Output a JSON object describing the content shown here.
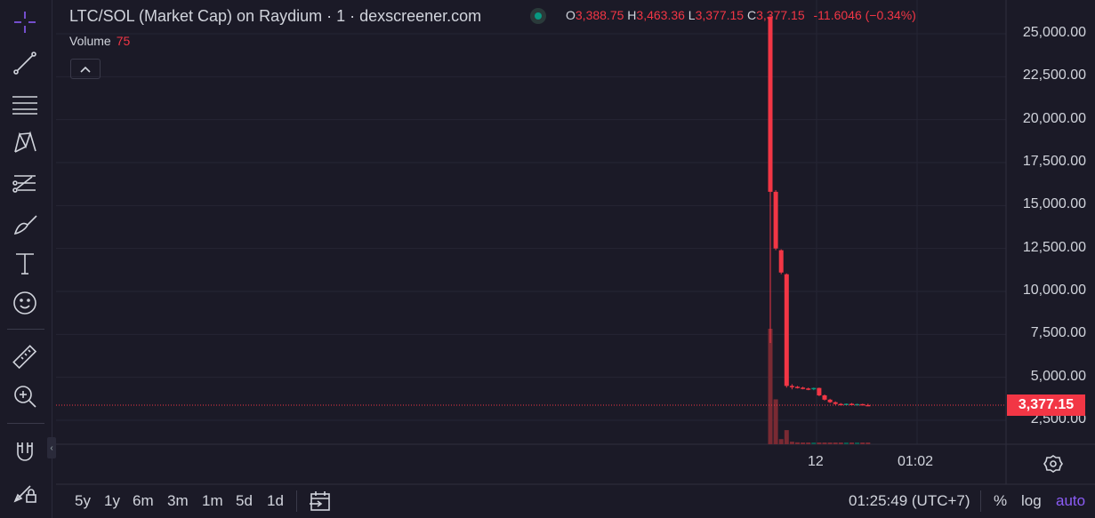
{
  "chart_title": "LTC/SOL (Market Cap) on Raydium · 1 · dexscreener.com",
  "ohlc": {
    "o_label": "O",
    "o_value": "3,388.75",
    "h_label": "H",
    "h_value": "3,463.36",
    "l_label": "L",
    "l_value": "3,377.15",
    "c_label": "C",
    "c_value": "3,377.15",
    "change": "-11.6046 (−0.34%)"
  },
  "volume": {
    "label": "Volume",
    "value": "75"
  },
  "y_axis_ticks": [
    "25,000.00",
    "22,500.00",
    "20,000.00",
    "17,500.00",
    "15,000.00",
    "12,500.00",
    "10,000.00",
    "7,500.00",
    "5,000.00",
    "2,500.00"
  ],
  "last_price": "3,377.15",
  "x_axis_ticks": [
    "12",
    "01:02"
  ],
  "ranges": [
    "5y",
    "1y",
    "6m",
    "3m",
    "1m",
    "5d",
    "1d"
  ],
  "clock": "01:25:49 (UTC+7)",
  "scale_options": {
    "percent": "%",
    "log": "log",
    "auto": "auto"
  },
  "colors": {
    "down": "#f23645",
    "up": "#089981",
    "auto": "#8b5cf6"
  },
  "tools": [
    "crosshair-icon",
    "trend-line-icon",
    "horizontal-lines-icon",
    "pattern-icon",
    "fib-icon",
    "brush-icon",
    "text-icon",
    "emoji-icon",
    "ruler-icon",
    "zoom-in-icon",
    "magnet-icon",
    "lock-drawing-icon"
  ],
  "chart_data": {
    "type": "candlestick",
    "title": "LTC/SOL (Market Cap) on Raydium · 1 · dexscreener.com",
    "ylim": [
      1500,
      26000
    ],
    "y_ticks": [
      2500,
      5000,
      7500,
      10000,
      12500,
      15000,
      17500,
      20000,
      22500,
      25000
    ],
    "x_ticks": [
      "12",
      "01:02"
    ],
    "candles": [
      {
        "o": 26000,
        "h": 26000,
        "l": 7000,
        "c": 15800,
        "dir": "down"
      },
      {
        "o": 15800,
        "h": 15900,
        "l": 12400,
        "c": 12500,
        "dir": "down"
      },
      {
        "o": 12400,
        "h": 12450,
        "l": 11000,
        "c": 11100,
        "dir": "down"
      },
      {
        "o": 11000,
        "h": 11050,
        "l": 4400,
        "c": 4500,
        "dir": "down"
      },
      {
        "o": 4500,
        "h": 4600,
        "l": 4300,
        "c": 4450,
        "dir": "down"
      },
      {
        "o": 4450,
        "h": 4500,
        "l": 4350,
        "c": 4400,
        "dir": "down"
      },
      {
        "o": 4400,
        "h": 4450,
        "l": 4300,
        "c": 4350,
        "dir": "down"
      },
      {
        "o": 4350,
        "h": 4400,
        "l": 4250,
        "c": 4300,
        "dir": "down"
      },
      {
        "o": 4300,
        "h": 4400,
        "l": 4250,
        "c": 4380,
        "dir": "up"
      },
      {
        "o": 4380,
        "h": 4400,
        "l": 3900,
        "c": 3950,
        "dir": "down"
      },
      {
        "o": 3950,
        "h": 4000,
        "l": 3650,
        "c": 3700,
        "dir": "down"
      },
      {
        "o": 3700,
        "h": 3750,
        "l": 3500,
        "c": 3550,
        "dir": "down"
      },
      {
        "o": 3550,
        "h": 3600,
        "l": 3400,
        "c": 3450,
        "dir": "down"
      },
      {
        "o": 3450,
        "h": 3500,
        "l": 3400,
        "c": 3420,
        "dir": "down"
      },
      {
        "o": 3420,
        "h": 3480,
        "l": 3400,
        "c": 3460,
        "dir": "up"
      },
      {
        "o": 3460,
        "h": 3500,
        "l": 3380,
        "c": 3400,
        "dir": "down"
      },
      {
        "o": 3400,
        "h": 3470,
        "l": 3380,
        "c": 3440,
        "dir": "up"
      },
      {
        "o": 3440,
        "h": 3460,
        "l": 3377,
        "c": 3390,
        "dir": "down"
      },
      {
        "o": 3389,
        "h": 3463,
        "l": 3377,
        "c": 3377,
        "dir": "down"
      }
    ],
    "volumes": [
      9000,
      3500,
      400,
      1100,
      200,
      150,
      120,
      120,
      100,
      140,
      110,
      90,
      90,
      80,
      80,
      80,
      80,
      80,
      75
    ]
  }
}
